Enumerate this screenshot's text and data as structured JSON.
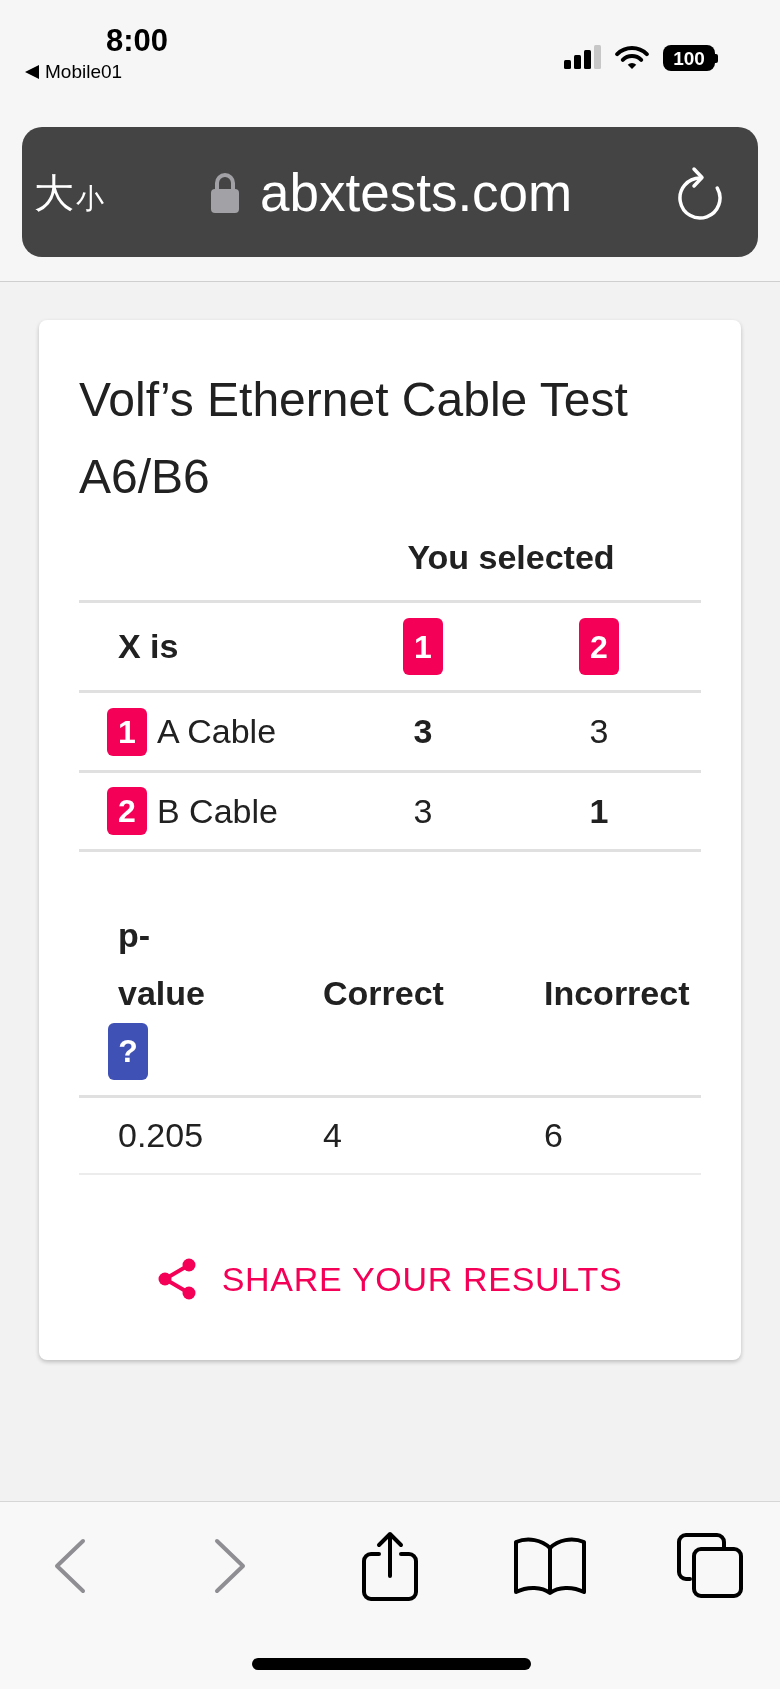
{
  "status_bar": {
    "time": "8:00",
    "back_to_app": "Mobile01",
    "battery": "100"
  },
  "address_bar": {
    "text_size": {
      "large": "大",
      "small": "小"
    },
    "url": "abxtests.com"
  },
  "result_card": {
    "title": "Volf’s Ethernet Cable Test A6/B6",
    "selection_table": {
      "group_header": "You selected",
      "corner_header": "X is",
      "column_badges": [
        "1",
        "2"
      ],
      "rows": [
        {
          "badge": "1",
          "label": "A Cable",
          "counts": [
            {
              "value": "3",
              "emphasized": true
            },
            {
              "value": "3",
              "emphasized": false
            }
          ]
        },
        {
          "badge": "2",
          "label": "B Cable",
          "counts": [
            {
              "value": "3",
              "emphasized": false
            },
            {
              "value": "1",
              "emphasized": true
            }
          ]
        }
      ]
    },
    "stats_table": {
      "columns": [
        {
          "label": "p-value",
          "help": "?"
        },
        {
          "label": "Correct"
        },
        {
          "label": "Incorrect"
        }
      ],
      "rows": [
        [
          "0.205",
          "4",
          "6"
        ]
      ]
    },
    "share_button": {
      "label": "SHARE YOUR RESULTS"
    }
  },
  "toolbar": {
    "buttons": [
      {
        "kind": "back",
        "disabled": true
      },
      {
        "kind": "forward",
        "disabled": true
      },
      {
        "kind": "share",
        "disabled": false
      },
      {
        "kind": "bookmarks",
        "disabled": false
      },
      {
        "kind": "tabs",
        "disabled": false
      }
    ]
  }
}
